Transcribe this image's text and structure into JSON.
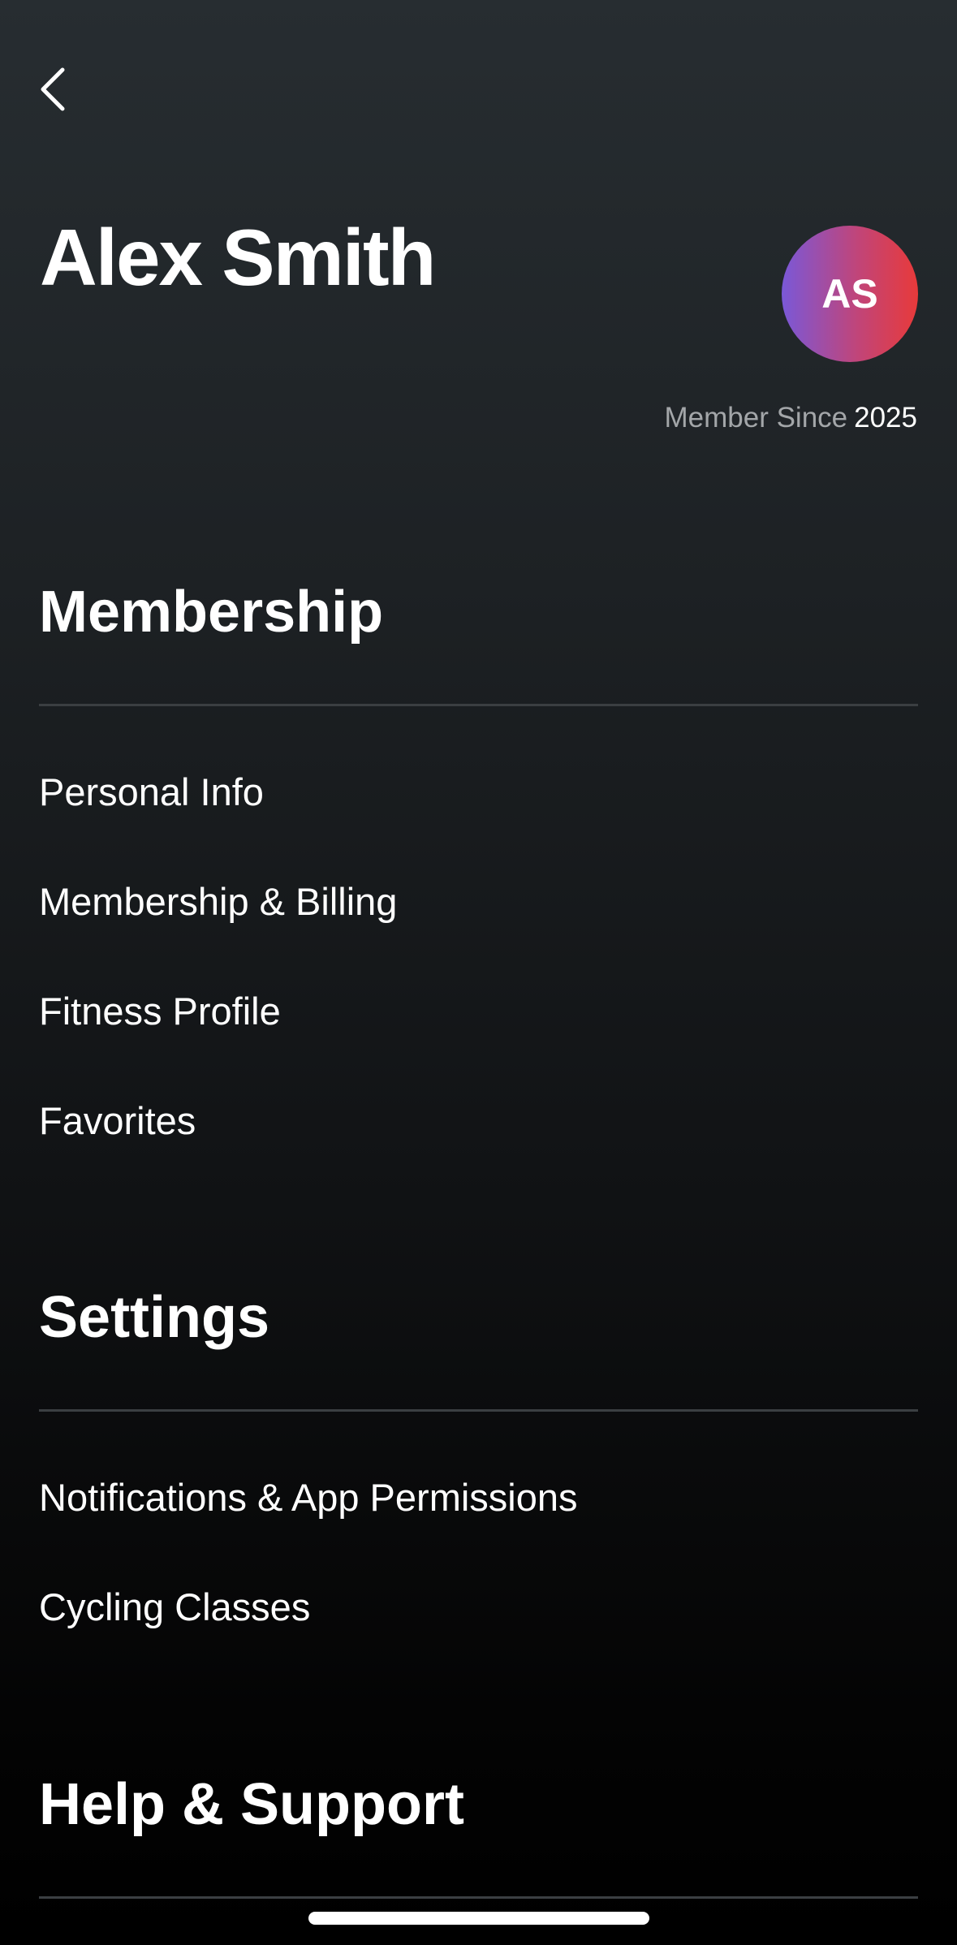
{
  "profile": {
    "name": "Alex Smith",
    "initials": "AS",
    "member_since_label": "Member Since",
    "member_since_year": "2025"
  },
  "sections": {
    "membership": {
      "title": "Membership",
      "items": [
        "Personal Info",
        "Membership & Billing",
        "Fitness Profile",
        "Favorites"
      ]
    },
    "settings": {
      "title": "Settings",
      "items": [
        "Notifications & App Permissions",
        "Cycling Classes"
      ]
    },
    "help": {
      "title": "Help & Support"
    }
  },
  "icons": {
    "back": "chevron-left-icon"
  },
  "colors": {
    "avatar_gradient_start": "#7a58d8",
    "avatar_gradient_end": "#e83a3a",
    "secondary_text": "#a3a6a9"
  }
}
